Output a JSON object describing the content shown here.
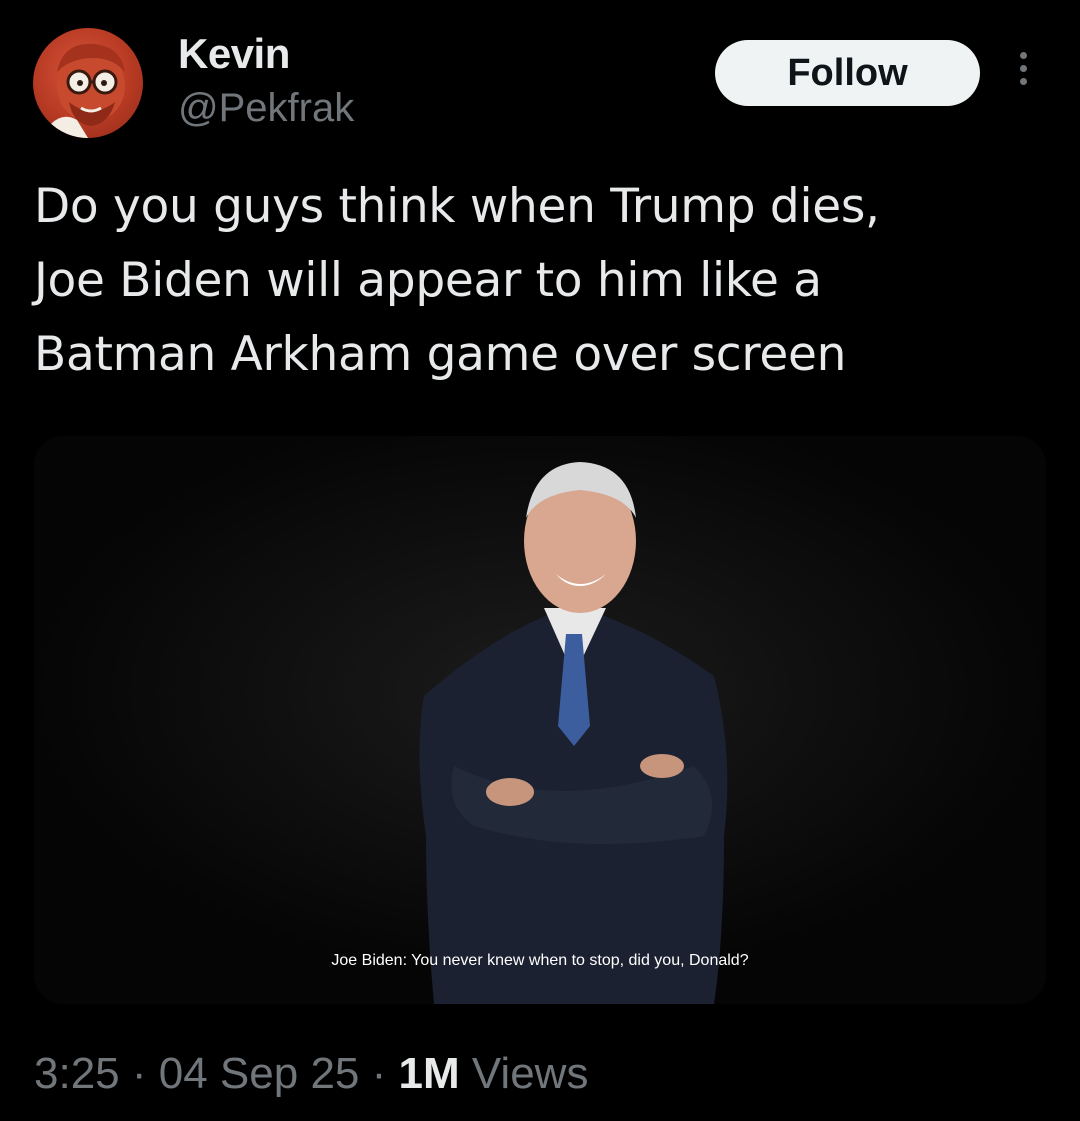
{
  "user": {
    "name": "Kevin",
    "handle": "@Pekfrak",
    "avatar_icon": "cartoon-avatar-icon"
  },
  "actions": {
    "follow_label": "Follow",
    "more_icon": "more-options-icon"
  },
  "tweet": {
    "lines": [
      "Do you guys think when Trump dies,",
      "Joe Biden will appear to him like a",
      "Batman Arkham game over screen"
    ]
  },
  "media": {
    "subtitle": "Joe Biden: You never knew when to stop, did you, Donald?"
  },
  "meta": {
    "time": "3:25",
    "date": "04 Sep 25",
    "views_count": "1M",
    "views_label": "Views",
    "separator": "·"
  },
  "colors": {
    "background": "#000000",
    "primary_text": "#e7e9ea",
    "secondary_text": "#71767b",
    "follow_bg": "#eff3f4"
  }
}
